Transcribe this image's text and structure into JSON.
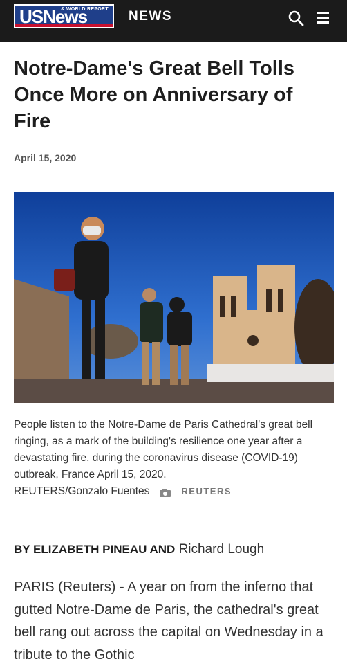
{
  "header": {
    "logo_text": "USNews",
    "logo_small": "& WORLD REPORT",
    "section": "NEWS",
    "icons": [
      "search-icon",
      "menu-icon"
    ]
  },
  "article": {
    "headline": "Notre-Dame's Great Bell Tolls Once More on Anniversary of Fire",
    "date": "April 15, 2020",
    "caption": "People listen to the Notre-Dame de Paris Cathedral's great bell ringing, as a mark of the building's resilience one year after a devastating fire, during the coronavirus disease (COVID-19) outbreak, France April 15, 2020.",
    "photo_credit": "REUTERS/Gonzalo Fuentes",
    "credit_source": "REUTERS",
    "byline_caps": "BY ELIZABETH PINEAU AND",
    "byline_name": "Richard Lough",
    "body": "PARIS (Reuters) - A year on from the inferno that gutted Notre-Dame de Paris, the cathedral's great bell rang out across the capital on Wednesday in a tribute to the Gothic"
  },
  "colors": {
    "topbar": "#1b1b1b",
    "logo_blue": "#1f3f8a",
    "logo_red": "#c8102e",
    "sky": "#1f5fbf"
  }
}
